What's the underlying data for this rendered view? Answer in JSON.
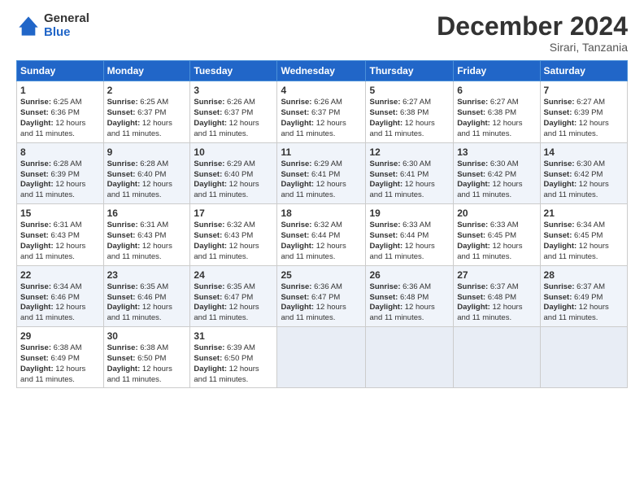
{
  "logo": {
    "general": "General",
    "blue": "Blue"
  },
  "header": {
    "month": "December 2024",
    "location": "Sirari, Tanzania"
  },
  "days_of_week": [
    "Sunday",
    "Monday",
    "Tuesday",
    "Wednesday",
    "Thursday",
    "Friday",
    "Saturday"
  ],
  "weeks": [
    [
      {
        "day": "1",
        "sunrise": "6:25 AM",
        "sunset": "6:36 PM",
        "daylight": "12 hours and 11 minutes."
      },
      {
        "day": "2",
        "sunrise": "6:25 AM",
        "sunset": "6:37 PM",
        "daylight": "12 hours and 11 minutes."
      },
      {
        "day": "3",
        "sunrise": "6:26 AM",
        "sunset": "6:37 PM",
        "daylight": "12 hours and 11 minutes."
      },
      {
        "day": "4",
        "sunrise": "6:26 AM",
        "sunset": "6:37 PM",
        "daylight": "12 hours and 11 minutes."
      },
      {
        "day": "5",
        "sunrise": "6:27 AM",
        "sunset": "6:38 PM",
        "daylight": "12 hours and 11 minutes."
      },
      {
        "day": "6",
        "sunrise": "6:27 AM",
        "sunset": "6:38 PM",
        "daylight": "12 hours and 11 minutes."
      },
      {
        "day": "7",
        "sunrise": "6:27 AM",
        "sunset": "6:39 PM",
        "daylight": "12 hours and 11 minutes."
      }
    ],
    [
      {
        "day": "8",
        "sunrise": "6:28 AM",
        "sunset": "6:39 PM",
        "daylight": "12 hours and 11 minutes."
      },
      {
        "day": "9",
        "sunrise": "6:28 AM",
        "sunset": "6:40 PM",
        "daylight": "12 hours and 11 minutes."
      },
      {
        "day": "10",
        "sunrise": "6:29 AM",
        "sunset": "6:40 PM",
        "daylight": "12 hours and 11 minutes."
      },
      {
        "day": "11",
        "sunrise": "6:29 AM",
        "sunset": "6:41 PM",
        "daylight": "12 hours and 11 minutes."
      },
      {
        "day": "12",
        "sunrise": "6:30 AM",
        "sunset": "6:41 PM",
        "daylight": "12 hours and 11 minutes."
      },
      {
        "day": "13",
        "sunrise": "6:30 AM",
        "sunset": "6:42 PM",
        "daylight": "12 hours and 11 minutes."
      },
      {
        "day": "14",
        "sunrise": "6:30 AM",
        "sunset": "6:42 PM",
        "daylight": "12 hours and 11 minutes."
      }
    ],
    [
      {
        "day": "15",
        "sunrise": "6:31 AM",
        "sunset": "6:43 PM",
        "daylight": "12 hours and 11 minutes."
      },
      {
        "day": "16",
        "sunrise": "6:31 AM",
        "sunset": "6:43 PM",
        "daylight": "12 hours and 11 minutes."
      },
      {
        "day": "17",
        "sunrise": "6:32 AM",
        "sunset": "6:43 PM",
        "daylight": "12 hours and 11 minutes."
      },
      {
        "day": "18",
        "sunrise": "6:32 AM",
        "sunset": "6:44 PM",
        "daylight": "12 hours and 11 minutes."
      },
      {
        "day": "19",
        "sunrise": "6:33 AM",
        "sunset": "6:44 PM",
        "daylight": "12 hours and 11 minutes."
      },
      {
        "day": "20",
        "sunrise": "6:33 AM",
        "sunset": "6:45 PM",
        "daylight": "12 hours and 11 minutes."
      },
      {
        "day": "21",
        "sunrise": "6:34 AM",
        "sunset": "6:45 PM",
        "daylight": "12 hours and 11 minutes."
      }
    ],
    [
      {
        "day": "22",
        "sunrise": "6:34 AM",
        "sunset": "6:46 PM",
        "daylight": "12 hours and 11 minutes."
      },
      {
        "day": "23",
        "sunrise": "6:35 AM",
        "sunset": "6:46 PM",
        "daylight": "12 hours and 11 minutes."
      },
      {
        "day": "24",
        "sunrise": "6:35 AM",
        "sunset": "6:47 PM",
        "daylight": "12 hours and 11 minutes."
      },
      {
        "day": "25",
        "sunrise": "6:36 AM",
        "sunset": "6:47 PM",
        "daylight": "12 hours and 11 minutes."
      },
      {
        "day": "26",
        "sunrise": "6:36 AM",
        "sunset": "6:48 PM",
        "daylight": "12 hours and 11 minutes."
      },
      {
        "day": "27",
        "sunrise": "6:37 AM",
        "sunset": "6:48 PM",
        "daylight": "12 hours and 11 minutes."
      },
      {
        "day": "28",
        "sunrise": "6:37 AM",
        "sunset": "6:49 PM",
        "daylight": "12 hours and 11 minutes."
      }
    ],
    [
      {
        "day": "29",
        "sunrise": "6:38 AM",
        "sunset": "6:49 PM",
        "daylight": "12 hours and 11 minutes."
      },
      {
        "day": "30",
        "sunrise": "6:38 AM",
        "sunset": "6:50 PM",
        "daylight": "12 hours and 11 minutes."
      },
      {
        "day": "31",
        "sunrise": "6:39 AM",
        "sunset": "6:50 PM",
        "daylight": "12 hours and 11 minutes."
      },
      null,
      null,
      null,
      null
    ]
  ],
  "labels": {
    "sunrise": "Sunrise:",
    "sunset": "Sunset:",
    "daylight": "Daylight:"
  }
}
